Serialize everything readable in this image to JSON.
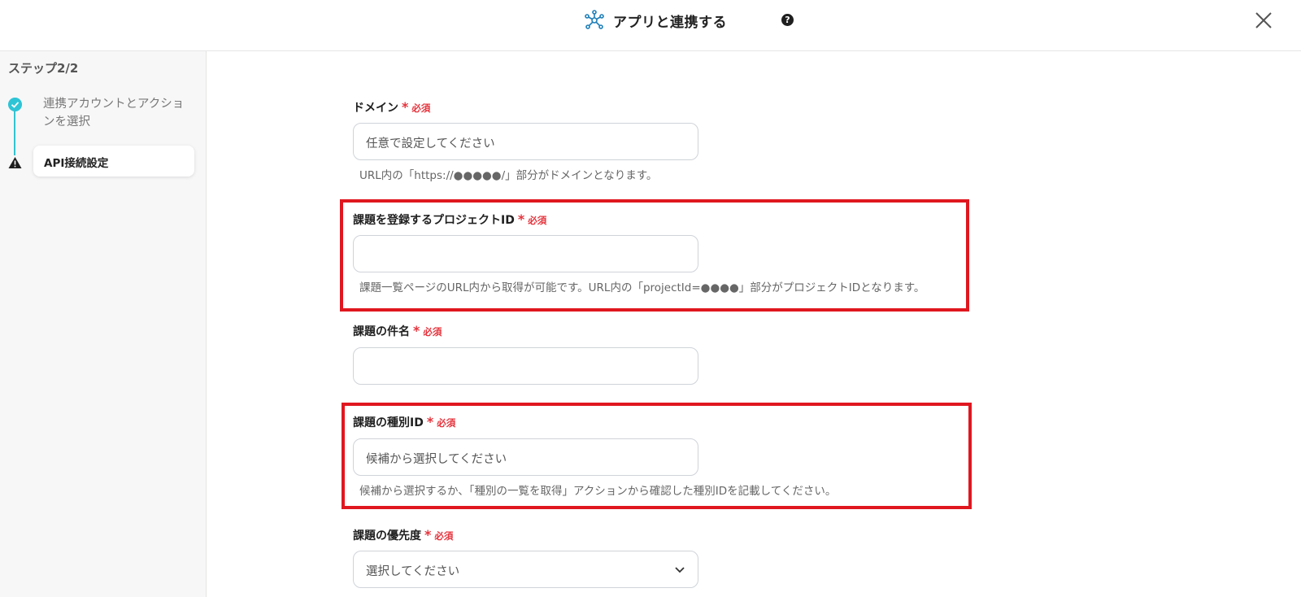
{
  "header": {
    "title": "アプリと連携する",
    "help_icon": "question-circle-icon",
    "close_icon": "close-icon"
  },
  "sidebar": {
    "step_header": "ステップ2/2",
    "steps": [
      {
        "label": "連携アカウントとアクションを選択",
        "status": "done",
        "icon": "check-circle-icon"
      },
      {
        "label": "API接続設定",
        "status": "warning",
        "icon": "warning-icon"
      }
    ]
  },
  "form": {
    "required_star": "*",
    "required_text": "必須",
    "fields": [
      {
        "label": "ドメイン",
        "placeholder": "任意で設定してください",
        "value": "",
        "hint": "URL内の「https://●●●●●/」部分がドメインとなります。"
      },
      {
        "label": "課題を登録するプロジェクトID",
        "placeholder": "",
        "value": "",
        "hint": "課題一覧ページのURL内から取得が可能です。URL内の「projectId=●●●●」部分がプロジェクトIDとなります。"
      },
      {
        "label": "課題の件名",
        "placeholder": "",
        "value": "",
        "hint": ""
      },
      {
        "label": "課題の種別ID",
        "placeholder": "候補から選択してください",
        "value": "",
        "hint": "候補から選択するか、「種別の一覧を取得」アクションから確認した種別IDを記載してください。"
      },
      {
        "label": "課題の優先度",
        "placeholder": "選択してください",
        "value": "",
        "hint": ""
      }
    ]
  },
  "colors": {
    "accent": "#2ec4d6",
    "required": "#e5343d",
    "highlight": "#e0171f"
  }
}
